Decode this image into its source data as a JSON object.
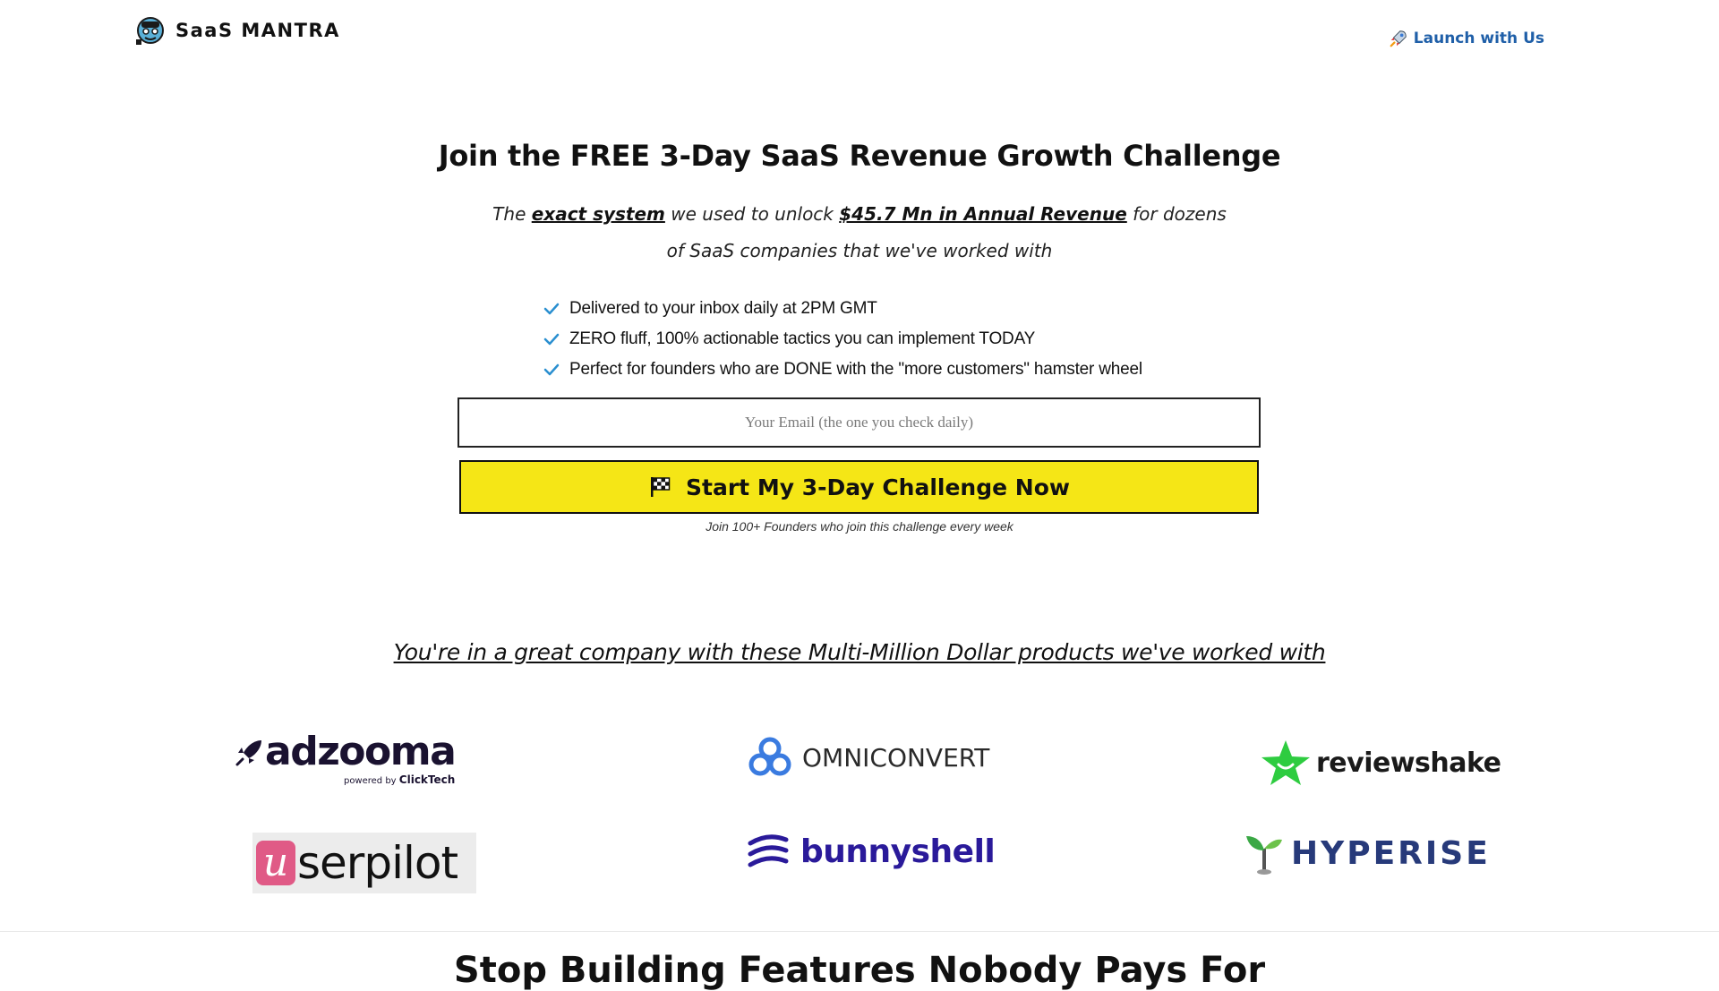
{
  "brand": {
    "name": "SaaS MANTRA",
    "logo_icon": "mascot-icon"
  },
  "nav": {
    "launch_label": "Launch with Us",
    "launch_icon": "rocket-icon"
  },
  "hero": {
    "title": "Join the FREE 3-Day SaaS Revenue Growth Challenge",
    "sub_prefix": "The ",
    "sub_link1": "exact system",
    "sub_mid": " we used to unlock ",
    "sub_link2": "$45.7 Mn in Annual Revenue",
    "sub_suffix": " for dozens of SaaS companies that we've worked with"
  },
  "bullets": [
    "Delivered to your inbox daily at 2PM GMT",
    "ZERO fluff, 100% actionable tactics you can implement TODAY",
    "Perfect for founders who are DONE with the \"more customers\" hamster wheel"
  ],
  "form": {
    "email_placeholder": "Your Email (the one you check daily)",
    "email_value": "",
    "cta_label": "Start My 3-Day Challenge Now",
    "cta_icon": "checkered-flag-icon",
    "cta_note": "Join 100+ Founders who join this challenge every week"
  },
  "companies": {
    "heading": "You're in a great company with these Multi-Million Dollar products we've worked with",
    "logos": {
      "adzooma": {
        "word": "adzooma",
        "sub_prefix": "powered by ",
        "sub_brand": "ClickTech"
      },
      "omniconvert": {
        "word": "OMNICONVERT"
      },
      "reviewshake": {
        "word": "reviewshake"
      },
      "userpilot": {
        "mark": "u",
        "word": "serpilot"
      },
      "bunnyshell": {
        "word": "bunnyshell"
      },
      "hyperise": {
        "word": "HYPERISE"
      }
    }
  },
  "next_section": {
    "heading": "Stop Building Features Nobody Pays For"
  },
  "colors": {
    "cta_bg": "#f5e616",
    "link_blue": "#1f5fa8",
    "check_blue": "#2a8fd0"
  }
}
